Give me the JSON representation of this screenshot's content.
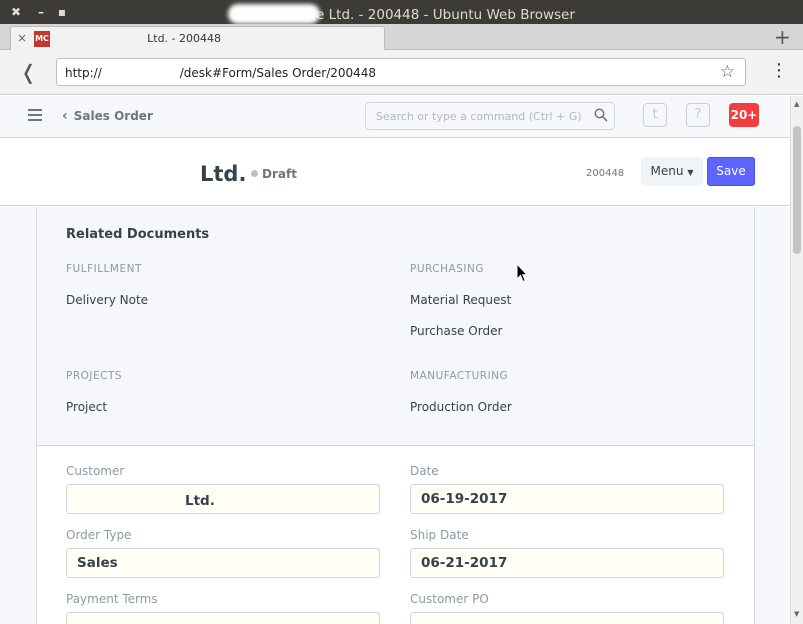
{
  "window": {
    "title": "e Ltd. - 200448 - Ubuntu Web Browser",
    "close_glyph": "✖",
    "minimize_glyph": "–",
    "maximize_glyph": "▪"
  },
  "tab": {
    "favicon_text": "MC",
    "title": "Ltd. - 200448",
    "close_glyph": "×",
    "new_tab_glyph": "+"
  },
  "address_bar": {
    "url_prefix": "http://",
    "url_suffix": "/desk#Form/Sales Order/200448",
    "star_glyph": "☆",
    "back_glyph": "❬",
    "menu_glyph": "⋮"
  },
  "navbar": {
    "breadcrumb": "Sales Order",
    "back_glyph": "‹",
    "search_placeholder": "Search or type a command (Ctrl + G)",
    "user_icon_text": "t",
    "help_icon_text": "?",
    "notification_count": "20+"
  },
  "page_head": {
    "title": "Ltd.",
    "status": "Draft",
    "doc_number": "200448",
    "menu_label": "Menu",
    "save_label": "Save"
  },
  "related": {
    "heading": "Related Documents",
    "groups": [
      {
        "heading": "FULFILLMENT",
        "items": [
          "Delivery Note"
        ]
      },
      {
        "heading": "PURCHASING",
        "items": [
          "Material Request",
          "Purchase Order"
        ]
      },
      {
        "heading": "PROJECTS",
        "items": [
          "Project"
        ]
      },
      {
        "heading": "MANUFACTURING",
        "items": [
          "Production Order"
        ]
      }
    ]
  },
  "form": {
    "customer_label": "Customer",
    "customer_value": "Ltd.",
    "date_label": "Date",
    "date_value": "06-19-2017",
    "order_type_label": "Order Type",
    "order_type_value": "Sales",
    "ship_date_label": "Ship Date",
    "ship_date_value": "06-21-2017",
    "payment_terms_label": "Payment Terms",
    "customer_po_label": "Customer PO"
  },
  "colors": {
    "primary": "#5e64ff",
    "notification": "#f53d3d",
    "titlebar": "#3c3b37"
  }
}
